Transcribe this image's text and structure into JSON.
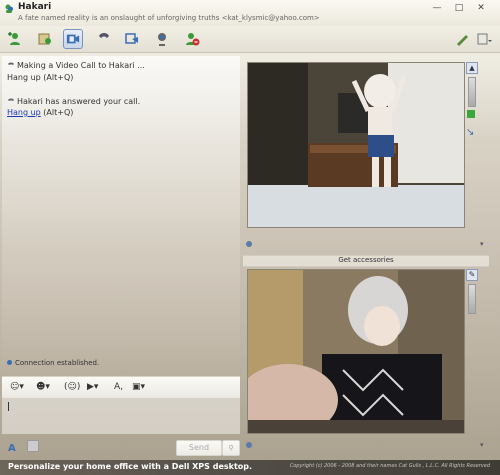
{
  "window": {
    "title": "Hakari",
    "subtitle": "A fate named reality is an onslaught of unforgiving truths <kat_klysmic@yahoo.com>",
    "controls": [
      "minimize",
      "maximize",
      "close"
    ]
  },
  "toolbar": {
    "buttons": [
      "add-contact-icon",
      "send-files-icon",
      "video-call-icon",
      "call-icon",
      "share-icon",
      "webcam-icon",
      "block-icon",
      "pen-icon",
      "menu-icon"
    ]
  },
  "conversation": {
    "messages": [
      {
        "text": "Making a Video Call to Hakari ...",
        "action": "Hang up (Alt+Q)",
        "action_link": false
      },
      {
        "text": "Hakari has answered your call.",
        "action_link_text": "Hang up",
        "action_suffix": " (Alt+Q)",
        "action_link": true
      }
    ],
    "status": "Connection established."
  },
  "format_bar": {
    "buttons": [
      "emoticon-icon",
      "wink-icon",
      "nudge-icon",
      "voice-clip-icon",
      "font-icon",
      "background-icon"
    ]
  },
  "compose": {
    "value": "",
    "font_label": "A",
    "send_label": "Send",
    "search_label": "Search"
  },
  "video": {
    "accessories_label": "Get accessories"
  },
  "ad": {
    "text": "Personalize your home office with a Dell XPS desktop.",
    "copyright": "Copyright (c) 2006 - 2008 and their names Cat Gulls , L.L.C. All Rights Reserved"
  },
  "colors": {
    "link": "#1a3bb5",
    "accent": "#7b93b8"
  }
}
